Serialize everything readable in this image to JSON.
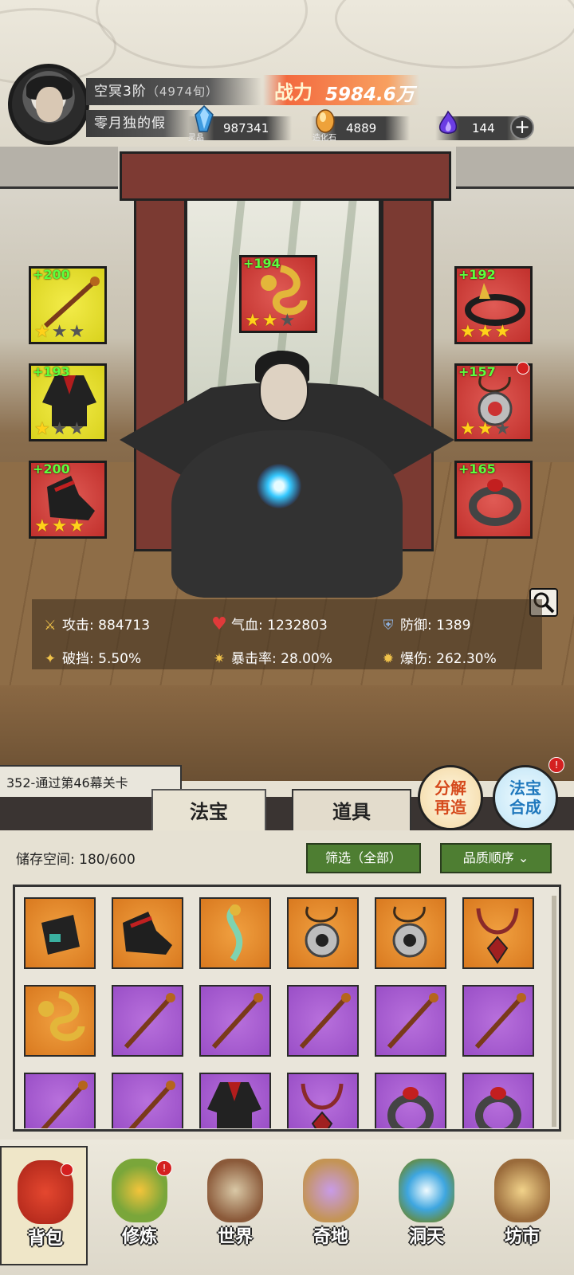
{
  "player": {
    "realm": "空冥3阶",
    "realm_progress": "（4974旬）",
    "name": "零月独的假",
    "power_label": "战力",
    "power_value": "5984.6万"
  },
  "resources": [
    {
      "icon": "spirit-crystal-icon",
      "label": "灵晶",
      "value": "987341",
      "color": "#4aa8e8"
    },
    {
      "icon": "creation-stone-icon",
      "label": "造化石",
      "value": "4889",
      "color": "#e8a030"
    },
    {
      "icon": "purple-flame-icon",
      "label": "",
      "value": "144",
      "color": "#6a3ee0"
    }
  ],
  "equipment": {
    "left": [
      {
        "name": "staff",
        "bonus": "+200",
        "stars": 1,
        "max_stars": 3,
        "rarity": "yellow"
      },
      {
        "name": "robe",
        "bonus": "+193",
        "stars": 1,
        "max_stars": 3,
        "rarity": "yellow"
      },
      {
        "name": "boots",
        "bonus": "+200",
        "stars": 3,
        "max_stars": 3,
        "rarity": "red"
      }
    ],
    "center": {
      "name": "talisman",
      "bonus": "+194",
      "stars": 2,
      "max_stars": 3,
      "rarity": "red"
    },
    "right": [
      {
        "name": "crown",
        "bonus": "+192",
        "stars": 3,
        "max_stars": 3,
        "rarity": "red"
      },
      {
        "name": "pendant",
        "bonus": "+157",
        "stars": 2,
        "max_stars": 3,
        "rarity": "red",
        "alert": true
      },
      {
        "name": "ring",
        "bonus": "+165",
        "stars": 0,
        "max_stars": 0,
        "rarity": "red"
      }
    ]
  },
  "stats": [
    {
      "icon": "sword-icon",
      "label": "攻击:",
      "value": "884713"
    },
    {
      "icon": "heart-icon",
      "label": "气血:",
      "value": "1232803"
    },
    {
      "icon": "shield-icon",
      "label": "防御:",
      "value": "1389"
    },
    {
      "icon": "break-icon",
      "label": "破挡:",
      "value": "5.50%"
    },
    {
      "icon": "crit-rate-icon",
      "label": "暴击率:",
      "value": "28.00%"
    },
    {
      "icon": "crit-damage-icon",
      "label": "爆伤:",
      "value": "262.30%"
    }
  ],
  "quest": {
    "text": "352-通过第46幕关卡"
  },
  "tabs": [
    {
      "label": "法宝"
    },
    {
      "label": "道具"
    }
  ],
  "actions": {
    "decompose": "分解再造",
    "synthesize": "法宝合成"
  },
  "inventory": {
    "storage_label": "储存空间:",
    "storage_value": "180/600",
    "filter_label": "筛选（全部）",
    "sort_label": "品质顺序",
    "items": [
      {
        "type": "bracer",
        "rarity": "orange"
      },
      {
        "type": "boots",
        "rarity": "orange"
      },
      {
        "type": "jade-dragon",
        "rarity": "orange"
      },
      {
        "type": "pendant",
        "rarity": "orange"
      },
      {
        "type": "pendant",
        "rarity": "orange"
      },
      {
        "type": "necklace",
        "rarity": "orange"
      },
      {
        "type": "talisman",
        "rarity": "orange"
      },
      {
        "type": "staff",
        "rarity": "purple"
      },
      {
        "type": "staff",
        "rarity": "purple"
      },
      {
        "type": "staff",
        "rarity": "purple"
      },
      {
        "type": "staff",
        "rarity": "purple"
      },
      {
        "type": "staff",
        "rarity": "purple"
      },
      {
        "type": "staff",
        "rarity": "purple"
      },
      {
        "type": "staff",
        "rarity": "purple"
      },
      {
        "type": "robe",
        "rarity": "purple"
      },
      {
        "type": "necklace",
        "rarity": "purple"
      },
      {
        "type": "ring",
        "rarity": "purple"
      },
      {
        "type": "ring",
        "rarity": "purple"
      }
    ]
  },
  "nav": [
    {
      "label": "背包",
      "icon": "bag-icon",
      "alert": true
    },
    {
      "label": "修炼",
      "icon": "lotus-icon",
      "alert": true
    },
    {
      "label": "世界",
      "icon": "scroll-map-icon",
      "alert": false
    },
    {
      "label": "奇地",
      "icon": "pagoda-icon",
      "alert": false
    },
    {
      "label": "洞天",
      "icon": "portal-icon",
      "alert": false
    },
    {
      "label": "坊市",
      "icon": "market-icon",
      "alert": false
    }
  ]
}
